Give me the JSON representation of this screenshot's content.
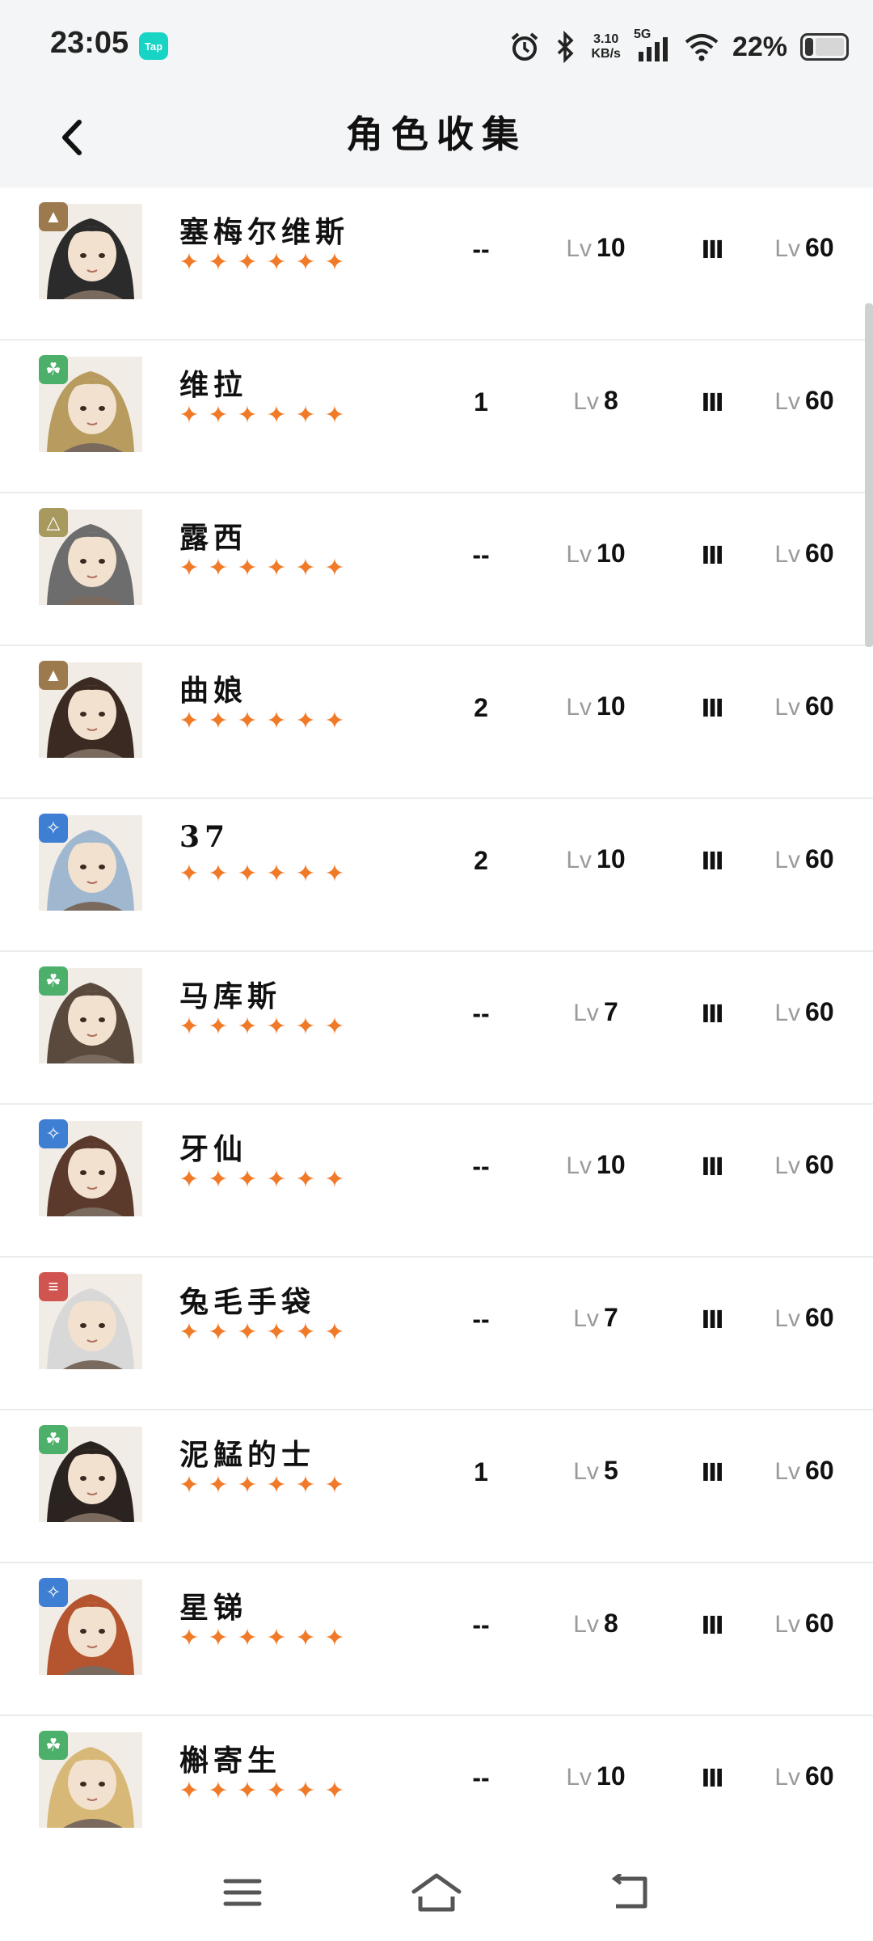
{
  "status": {
    "time": "23:05",
    "tap_badge": "Tap",
    "speed_value": "3.10",
    "speed_unit": "KB/s",
    "network": "5G",
    "battery": "22%"
  },
  "header": {
    "title": "角色收集"
  },
  "characters": [
    {
      "name": "塞梅尔维斯",
      "element": "brown",
      "dupes": "--",
      "level": "10",
      "rank": "Ⅲ",
      "max_level": "60",
      "lv_label": "Lv"
    },
    {
      "name": "维拉",
      "element": "green",
      "dupes": "1",
      "level": "8",
      "rank": "Ⅲ",
      "max_level": "60",
      "lv_label": "Lv"
    },
    {
      "name": "露西",
      "element": "olive",
      "dupes": "--",
      "level": "10",
      "rank": "Ⅲ",
      "max_level": "60",
      "lv_label": "Lv"
    },
    {
      "name": "曲娘",
      "element": "brown",
      "dupes": "2",
      "level": "10",
      "rank": "Ⅲ",
      "max_level": "60",
      "lv_label": "Lv"
    },
    {
      "name": "37",
      "element": "blue",
      "dupes": "2",
      "level": "10",
      "rank": "Ⅲ",
      "max_level": "60",
      "lv_label": "Lv"
    },
    {
      "name": "马库斯",
      "element": "green",
      "dupes": "--",
      "level": "7",
      "rank": "Ⅲ",
      "max_level": "60",
      "lv_label": "Lv"
    },
    {
      "name": "牙仙",
      "element": "blue",
      "dupes": "--",
      "level": "10",
      "rank": "Ⅲ",
      "max_level": "60",
      "lv_label": "Lv"
    },
    {
      "name": "兔毛手袋",
      "element": "red",
      "dupes": "--",
      "level": "7",
      "rank": "Ⅲ",
      "max_level": "60",
      "lv_label": "Lv"
    },
    {
      "name": "泥鯭的士",
      "element": "green",
      "dupes": "1",
      "level": "5",
      "rank": "Ⅲ",
      "max_level": "60",
      "lv_label": "Lv"
    },
    {
      "name": "星锑",
      "element": "blue",
      "dupes": "--",
      "level": "8",
      "rank": "Ⅲ",
      "max_level": "60",
      "lv_label": "Lv"
    },
    {
      "name": "槲寄生",
      "element": "green",
      "dupes": "--",
      "level": "10",
      "rank": "Ⅲ",
      "max_level": "60",
      "lv_label": "Lv"
    }
  ],
  "stars_per_character": 6,
  "colors": {
    "star": "#f07a28",
    "brown": "#9c7a4e",
    "green": "#4caf6a",
    "olive": "#a89a5e",
    "blue": "#3f7fd3",
    "red": "#d0544f"
  },
  "icons": {
    "back": "chevron-left-icon",
    "menu": "menu-icon",
    "home": "home-icon",
    "return": "return-icon"
  }
}
